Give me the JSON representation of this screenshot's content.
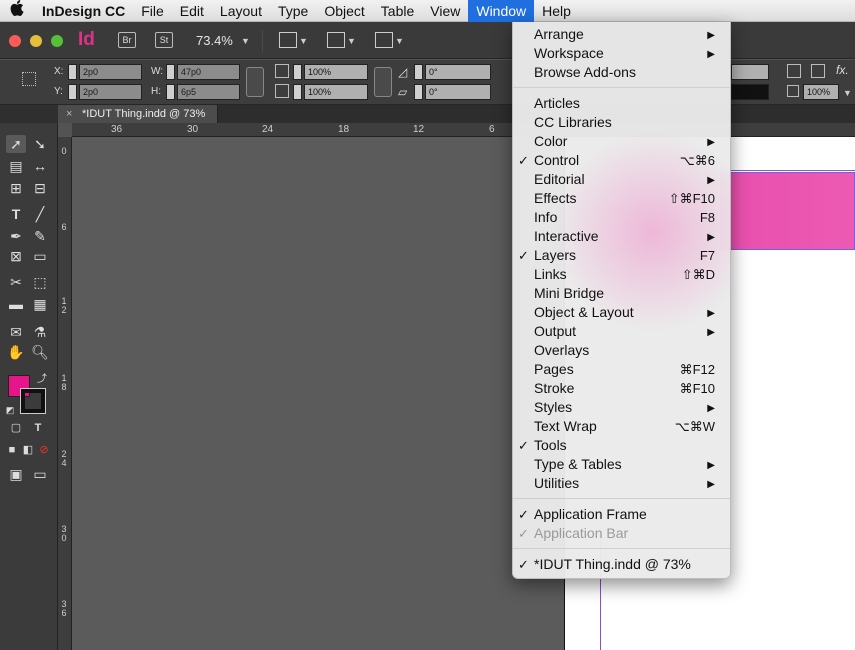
{
  "menubar": {
    "apple": "",
    "items": [
      "InDesign CC",
      "File",
      "Edit",
      "Layout",
      "Type",
      "Object",
      "Table",
      "View",
      "Window",
      "Help"
    ],
    "active": "Window"
  },
  "appbar": {
    "logo": "Id",
    "bridge_badge": "Br",
    "stock_badge": "St",
    "zoom": "73.4%"
  },
  "control": {
    "x_label": "X:",
    "x_value": "2p0",
    "y_label": "Y:",
    "y_value": "2p0",
    "w_label": "W:",
    "w_value": "47p0",
    "h_label": "H:",
    "h_value": "6p5",
    "scale_x": "100%",
    "scale_y": "100%",
    "rotate": "0°",
    "shear": "0°",
    "stroke_pct": "100%",
    "fx": "fx."
  },
  "tab": {
    "close": "×",
    "title": "*IDUT Thing.indd @ 73%"
  },
  "rulers": {
    "h": [
      "36",
      "30",
      "24",
      "18",
      "12",
      "6"
    ],
    "v": [
      "0",
      "6",
      "1 2",
      "1 8",
      "2 4",
      "3 0",
      "3 6"
    ]
  },
  "colors": {
    "fill": "#e8158a",
    "menu_highlight": "#1f6fe0",
    "frame_pink": "#e94fae"
  },
  "window_menu": {
    "group1": [
      {
        "label": "Arrange",
        "submenu": true
      },
      {
        "label": "Workspace",
        "submenu": true
      },
      {
        "label": "Browse Add-ons"
      }
    ],
    "group2": [
      {
        "label": "Articles"
      },
      {
        "label": "CC Libraries"
      },
      {
        "label": "Color",
        "submenu": true
      },
      {
        "label": "Control",
        "checked": true,
        "shortcut": "⌥⌘6"
      },
      {
        "label": "Editorial",
        "submenu": true
      },
      {
        "label": "Effects",
        "shortcut": "⇧⌘F10"
      },
      {
        "label": "Info",
        "shortcut": "F8"
      },
      {
        "label": "Interactive",
        "submenu": true
      },
      {
        "label": "Layers",
        "checked": true,
        "shortcut": "F7"
      },
      {
        "label": "Links",
        "shortcut": "⇧⌘D"
      },
      {
        "label": "Mini Bridge"
      },
      {
        "label": "Object & Layout",
        "submenu": true
      },
      {
        "label": "Output",
        "submenu": true
      },
      {
        "label": "Overlays"
      },
      {
        "label": "Pages",
        "shortcut": "⌘F12"
      },
      {
        "label": "Stroke",
        "shortcut": "⌘F10"
      },
      {
        "label": "Styles",
        "submenu": true
      },
      {
        "label": "Text Wrap",
        "shortcut": "⌥⌘W"
      },
      {
        "label": "Tools",
        "checked": true
      },
      {
        "label": "Type & Tables",
        "submenu": true
      },
      {
        "label": "Utilities",
        "submenu": true
      }
    ],
    "group3": [
      {
        "label": "Application Frame",
        "checked": true
      },
      {
        "label": "Application Bar",
        "checked": true,
        "disabled": true
      }
    ],
    "group4": [
      {
        "label": "*IDUT Thing.indd @ 73%",
        "checked": true
      }
    ],
    "check_glyph": "✓",
    "submenu_glyph": "▶"
  }
}
